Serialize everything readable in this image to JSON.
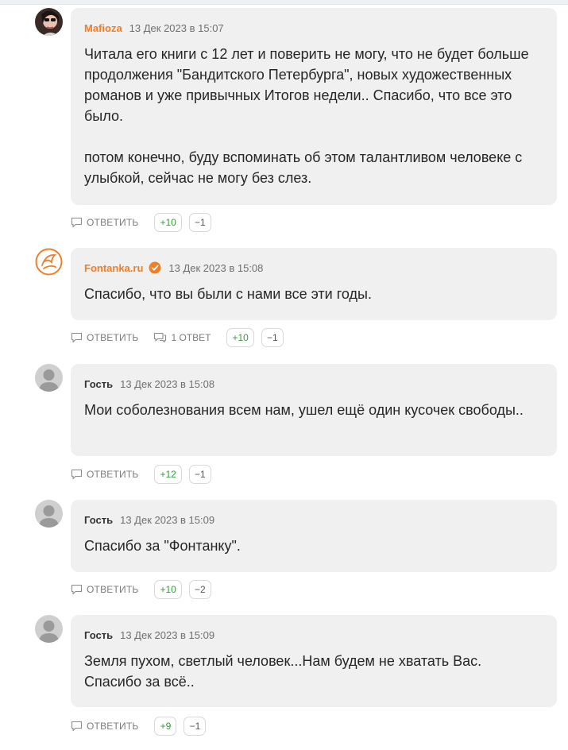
{
  "labels": {
    "reply": "ОТВЕТИТЬ"
  },
  "comments": [
    {
      "author": "Mafioza",
      "date": "13 Дек 2023 в 15:07",
      "paragraphs": [
        "Читала его книги с 12 лет и поверить не могу, что не будет больше продолжения \"Бандитского Петербурга\", новых художественных романов и уже привычных Итогов недели.. Спасибо, что все это было.",
        "потом конечно, буду вспоминать об этом талантливом человеке с улыбкой, сейчас не могу без слез."
      ],
      "upvotes": "+10",
      "downvotes": "−1"
    },
    {
      "author": "Fontanka.ru",
      "date": "13 Дек 2023 в 15:08",
      "paragraphs": [
        "Спасибо, что вы были с нами все эти годы."
      ],
      "replies_label": "1 ОТВЕТ",
      "upvotes": "+10",
      "downvotes": "−1"
    },
    {
      "author": "Гость",
      "date": "13 Дек 2023 в 15:08",
      "paragraphs": [
        "Мои соболезнования всем нам, ушел ещё один кусочек свободы.."
      ],
      "upvotes": "+12",
      "downvotes": "−1"
    },
    {
      "author": "Гость",
      "date": "13 Дек 2023 в 15:09",
      "paragraphs": [
        "Спасибо за \"Фонтанку\"."
      ],
      "upvotes": "+10",
      "downvotes": "−2"
    },
    {
      "author": "Гость",
      "date": "13 Дек 2023 в 15:09",
      "paragraphs": [
        "Земля пухом, светлый человек...Нам будем не хватать Вас. Спасибо за всё.."
      ],
      "upvotes": "+9",
      "downvotes": "−1"
    }
  ],
  "colors": {
    "accent": "#f07e26",
    "upvote": "#3a9a3a",
    "bubble": "#f0f0f0"
  }
}
